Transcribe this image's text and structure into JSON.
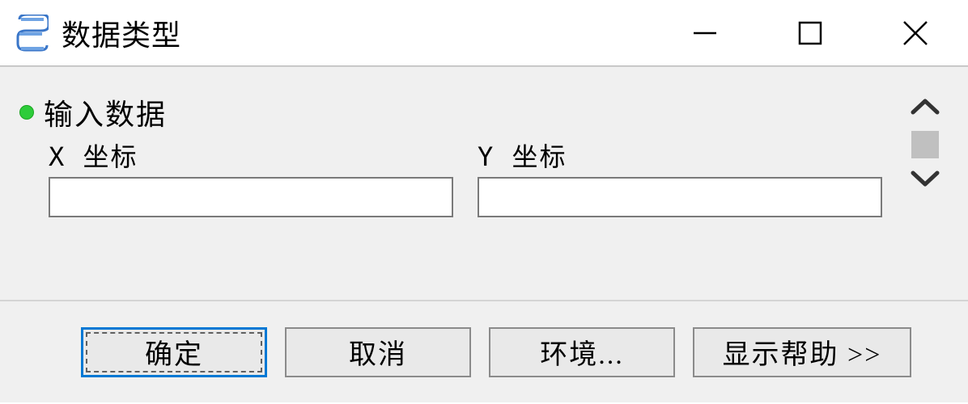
{
  "window": {
    "title": "数据类型"
  },
  "section": {
    "heading": "输入数据"
  },
  "fields": {
    "x": {
      "label": "X 坐标",
      "value": ""
    },
    "y": {
      "label": "Y 坐标",
      "value": ""
    }
  },
  "buttons": {
    "ok": "确定",
    "cancel": "取消",
    "environment": "环境...",
    "help": "显示帮助 >>"
  }
}
